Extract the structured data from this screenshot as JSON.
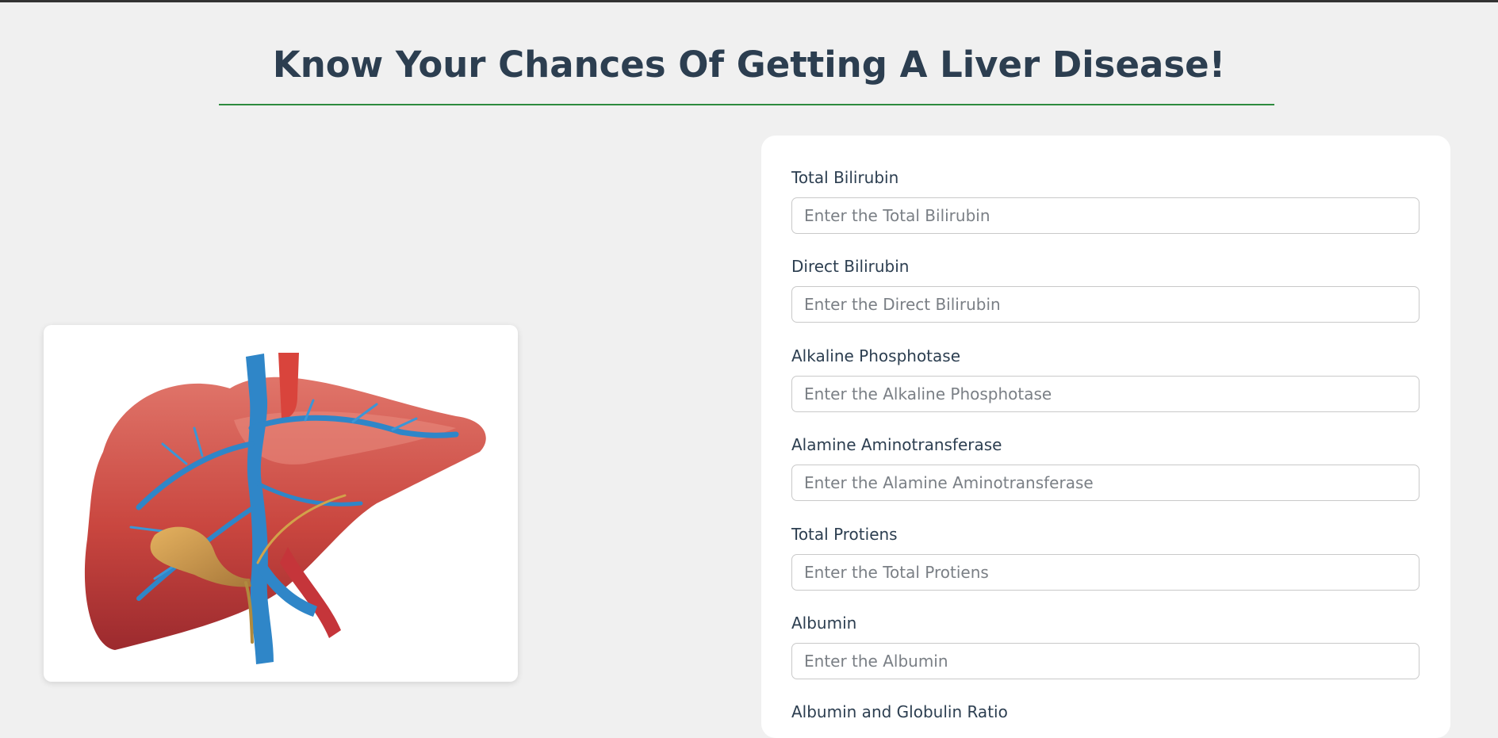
{
  "page": {
    "title": "Know Your Chances Of Getting A Liver Disease!"
  },
  "colors": {
    "title_text": "#2c3e50",
    "underline": "#2e8b3e",
    "background": "#f0f0f0",
    "card": "#ffffff"
  },
  "image": {
    "subject": "liver-illustration"
  },
  "form": {
    "fields": [
      {
        "label": "Total Bilirubin",
        "placeholder": "Enter the Total Bilirubin"
      },
      {
        "label": "Direct Bilirubin",
        "placeholder": "Enter the Direct Bilirubin"
      },
      {
        "label": "Alkaline Phosphotase",
        "placeholder": "Enter the Alkaline Phosphotase"
      },
      {
        "label": "Alamine Aminotransferase",
        "placeholder": "Enter the Alamine Aminotransferase"
      },
      {
        "label": "Total Protiens",
        "placeholder": "Enter the Total Protiens"
      },
      {
        "label": "Albumin",
        "placeholder": "Enter the Albumin"
      },
      {
        "label": "Albumin and Globulin Ratio"
      }
    ]
  }
}
